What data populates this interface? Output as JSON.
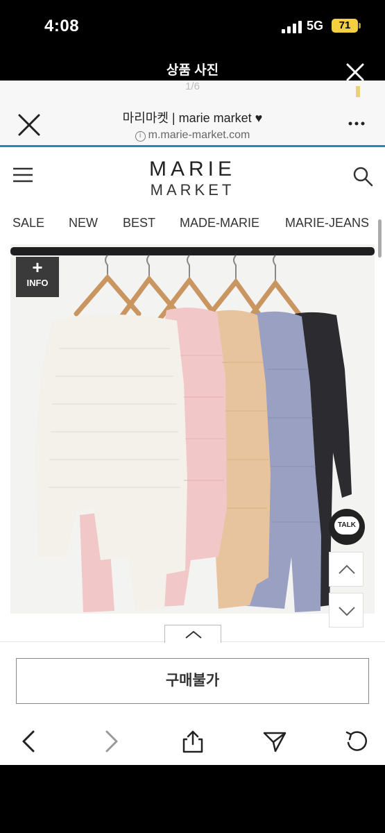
{
  "status_bar": {
    "time": "4:08",
    "network": "5G",
    "battery": "71"
  },
  "viewer": {
    "title": "상품 사진",
    "counter": "1/6"
  },
  "browser": {
    "title": "마리마켓 | marie market ♥",
    "url": "m.marie-market.com"
  },
  "site": {
    "logo_top": "MARIE",
    "logo_bottom": "MARKET",
    "nav": [
      "SALE",
      "NEW",
      "BEST",
      "MADE-MARIE",
      "MARIE-JEANS"
    ]
  },
  "product": {
    "info_plus": "+",
    "info_label": "INFO",
    "talk_label": "TALK",
    "sweater_colors": [
      "#f4f1ea",
      "#f2c7c7",
      "#e8c49e",
      "#9aa0c2",
      "#2b2b30"
    ]
  },
  "purchase": {
    "button_label": "구매불가"
  }
}
